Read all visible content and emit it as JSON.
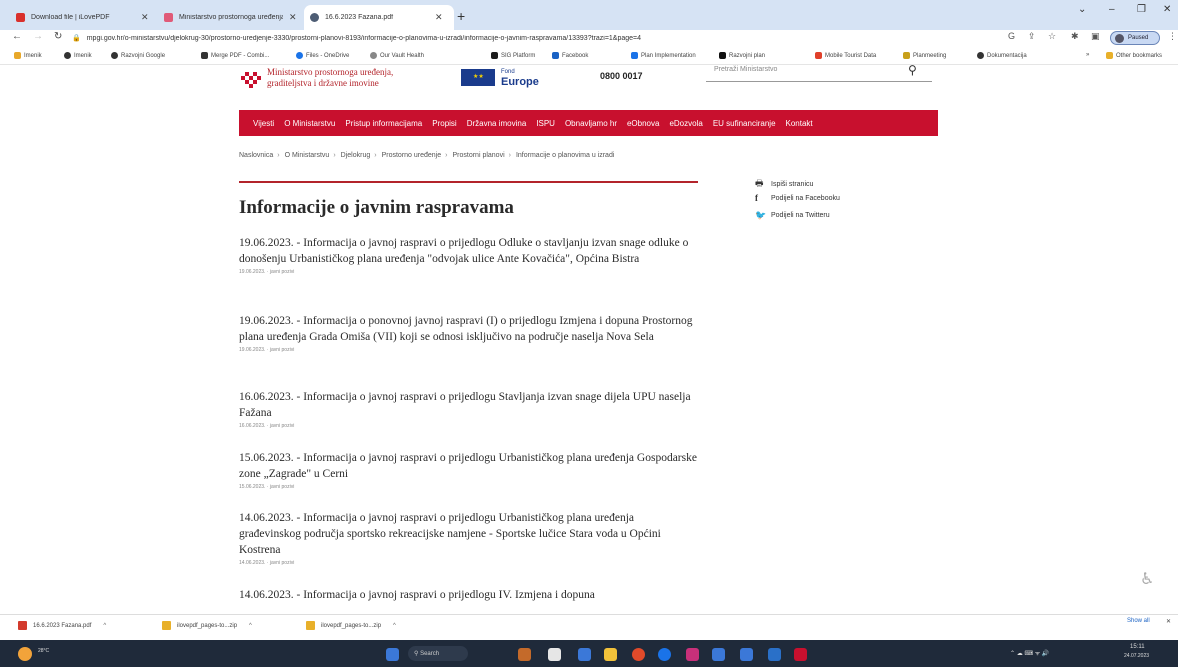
{
  "browser": {
    "tabs": [
      {
        "label": "Download file | iLovePDF",
        "color": "#d9302c",
        "active": false
      },
      {
        "label": "Ministarstvo prostornoga uređenja",
        "color": "#e05a78",
        "active": false
      },
      {
        "label": "16.6.2023 Fazana.pdf",
        "color": "#4d5d74",
        "active": true
      }
    ],
    "new_tab": "+",
    "window_controls": [
      "⌄",
      "–",
      "❐",
      "✕"
    ],
    "url": "mpgi.gov.hr/o-ministarstvu/djelokrug-30/prostorno-uredjenje-3330/prostorni-planovi-8193/informacije-o-planovima-u-izradi/informacije-o-javnim-raspravama/13393?trazi=1&page=4",
    "profile_label": "Paused",
    "bookmarks": [
      {
        "label": "Imenik",
        "color": "#e8a82a"
      },
      {
        "label": "Imenik",
        "color": "#333333"
      },
      {
        "label": "Razvojni Google",
        "color": "#333333"
      },
      {
        "label": "Merge PDF - Combi...",
        "color": "#333333"
      },
      {
        "label": "Files - OneDrive",
        "color": "#1a73e8"
      },
      {
        "label": "Our Vault Health",
        "color": "#888888"
      },
      {
        "label": "SIG Platform",
        "color": "#1c1c1c"
      },
      {
        "label": "Facebook",
        "color": "#1a62c4"
      },
      {
        "label": "Plan Implementation",
        "color": "#1a73e8"
      },
      {
        "label": "Razvojni plan",
        "color": "#111111"
      },
      {
        "label": "Mobile Tourist Data",
        "color": "#e0402a"
      },
      {
        "label": "Planmeeting",
        "color": "#c8a01a"
      },
      {
        "label": "Dokumentacija",
        "color": "#333333"
      },
      {
        "label": "Other bookmarks",
        "color": "#e8b02a"
      }
    ]
  },
  "site": {
    "logo_line1": "Ministarstvo prostornoga uređenja,",
    "logo_line2": "graditeljstva i državne imovine",
    "eu_big": "Europe",
    "eu_small": "Fond",
    "phone": "0800 0017",
    "search_placeholder": "Pretraži Ministarstvo",
    "nav": [
      "Vijesti",
      "O Ministarstvu",
      "Pristup informacijama",
      "Propisi",
      "Državna imovina",
      "ISPU",
      "Obnavljamo hr",
      "eObnova",
      "eDozvola",
      "EU sufinanciranje",
      "Kontakt"
    ],
    "breadcrumb": [
      "Naslovnica",
      "O Ministarstvu",
      "Djelokrug",
      "Prostorno uređenje",
      "Prostorni planovi",
      "Informacije o planovima u izradi"
    ],
    "share": [
      {
        "icon": "🖶",
        "label": "Ispiši stranicu"
      },
      {
        "icon": "f",
        "label": "Podijeli na Facebooku"
      },
      {
        "icon": "🐦",
        "label": "Podijeli na Twitteru"
      }
    ],
    "page_title": "Informacije o javnim raspravama",
    "items": [
      {
        "date": "19.06.2023.",
        "text": " - Informacija o javnoj raspravi o prijedlogu Odluke o stavljanju izvan snage odluke o donošenju Urbanističkog plana uređenja \"odvojak ulice Ante Kovačića\", Općina Bistra",
        "meta": "19.06.2023. · javni pozivi"
      },
      {
        "date": "19.06.2023.",
        "text": " - Informacija o ponovnoj javnoj raspravi (I) o prijedlogu Izmjena i dopuna Prostornog plana uređenja Grada Omiša (VII) koji se odnosi isključivo na područje naselja Nova Sela",
        "meta": "19.06.2023. · javni pozivi"
      },
      {
        "date": "16.06.2023.",
        "text": " - Informacija o javnoj raspravi o prijedlogu Stavljanja izvan snage dijela UPU naselja Fažana",
        "meta": "16.06.2023. · javni pozivi"
      },
      {
        "date": "15.06.2023.",
        "text": " - Informacija o javnoj raspravi o prijedlogu Urbanističkog plana uređenja Gospodarske zone „Zagrade\" u Cerni",
        "meta": "15.06.2023. · javni pozivi"
      },
      {
        "date": "14.06.2023.",
        "text": " - Informacija o javnoj raspravi o prijedlogu Urbanističkog plana uređenja građevinskog područja sportsko rekreacijske namjene - Sportske lučice Stara voda u Općini Kostrena",
        "meta": "14.06.2023. · javni pozivi"
      },
      {
        "date": "14.06.2023.",
        "text": " - Informacija o javnoj raspravi o prijedlogu IV. Izmjena i dopuna",
        "meta": ""
      }
    ]
  },
  "downloads": {
    "items": [
      {
        "label": "16.6.2023 Fazana.pdf",
        "color": "#d33a2c"
      },
      {
        "label": "ilovepdf_pages-to...zip",
        "color": "#e8b02a"
      },
      {
        "label": "ilovepdf_pages-to...zip",
        "color": "#e8b02a"
      }
    ],
    "show_all": "Show all"
  },
  "taskbar": {
    "weather": "28°C",
    "search": "Search",
    "apps": [
      "#c46a2a",
      "#e6e6e6",
      "#3b78d8",
      "#f2c23a",
      "#e04a2a",
      "#1a73e8",
      "#c8307a",
      "#3b78d8",
      "#3b78d8",
      "#2a70c8",
      "#c8102e"
    ],
    "clock": "15:11",
    "date": "24.07.2023"
  }
}
